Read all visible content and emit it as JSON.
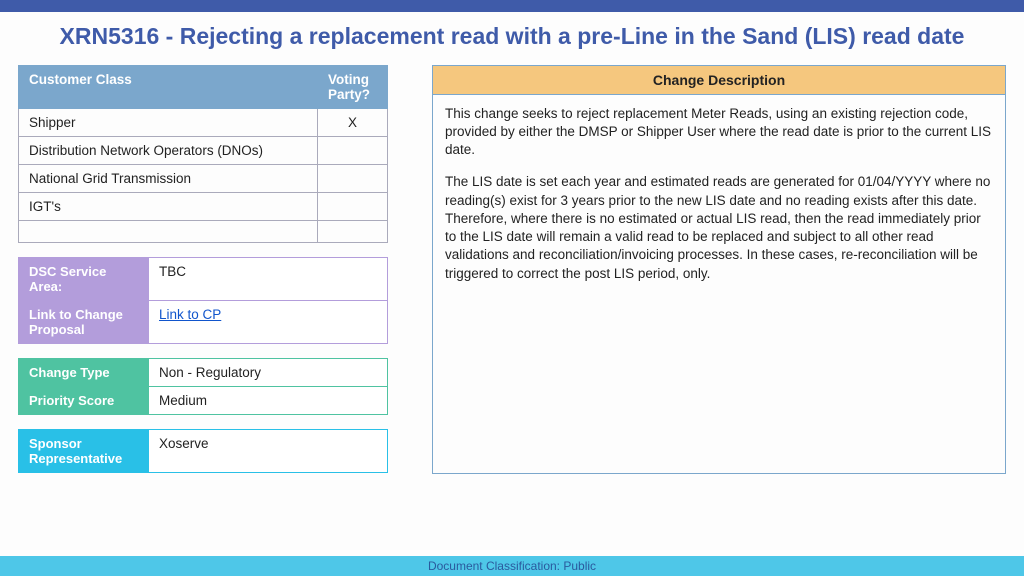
{
  "title": "XRN5316 - Rejecting a replacement read with a pre-Line in the Sand (LIS) read date",
  "customer_table": {
    "headers": [
      "Customer Class",
      "Voting Party?"
    ],
    "rows": [
      {
        "cls": "Shipper",
        "vote": "X"
      },
      {
        "cls": "Distribution Network Operators (DNOs)",
        "vote": ""
      },
      {
        "cls": "National Grid Transmission",
        "vote": ""
      },
      {
        "cls": "IGT's",
        "vote": ""
      }
    ]
  },
  "purple": {
    "dsc_label": "DSC Service Area:",
    "dsc_value": "TBC",
    "link_label": "Link to Change Proposal",
    "link_value": "Link to CP"
  },
  "green": {
    "type_label": "Change Type",
    "type_value": "Non - Regulatory",
    "priority_label": "Priority Score",
    "priority_value": "Medium"
  },
  "cyan": {
    "sponsor_label": "Sponsor Representative",
    "sponsor_value": "Xoserve"
  },
  "description": {
    "header": "Change Description",
    "p1": "This change seeks to reject replacement Meter Reads, using an existing rejection code, provided by either the DMSP or Shipper User where the read date is prior to the current LIS date.",
    "p2": "The LIS date is set each year and estimated reads are generated for 01/04/YYYY where no reading(s) exist for 3 years prior to the new LIS date and no reading exists after this date. Therefore, where there is no estimated or actual LIS read, then the read immediately prior to the LIS date will remain a valid read to be replaced and subject to all other read validations and reconciliation/invoicing processes. In these cases, re-reconciliation will be triggered to correct the post LIS period, only."
  },
  "footer": "Document Classification: Public"
}
